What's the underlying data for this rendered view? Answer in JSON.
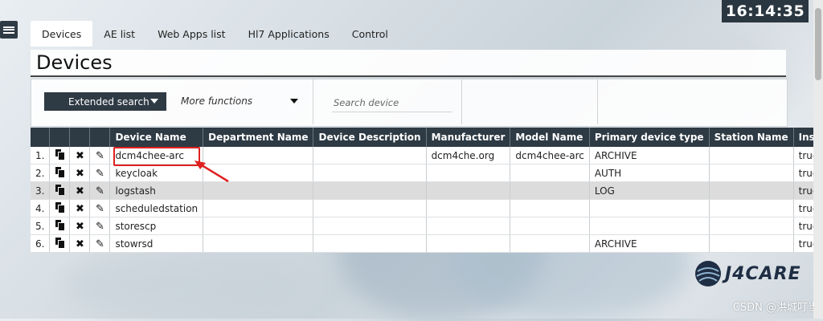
{
  "clock": "16:14:35",
  "tabs": [
    {
      "label": "Devices",
      "active": true
    },
    {
      "label": "AE list",
      "active": false
    },
    {
      "label": "Web Apps list",
      "active": false
    },
    {
      "label": "Hl7 Applications",
      "active": false
    },
    {
      "label": "Control",
      "active": false
    }
  ],
  "page_title": "Devices",
  "search_bar": {
    "extended_search_label": "Extended search",
    "more_functions_label": "More functions",
    "search_placeholder": "Search device"
  },
  "table": {
    "columns": [
      "Device Name",
      "Department Name",
      "Device Description",
      "Manufacturer",
      "Model Name",
      "Primary device type",
      "Station Name",
      "Installed"
    ],
    "rows": [
      {
        "index": "1.",
        "device_name": "dcm4chee-arc",
        "department": "",
        "description": "",
        "manufacturer": "dcm4che.org",
        "model": "dcm4chee-arc",
        "type": "ARCHIVE",
        "station": "",
        "installed": "true"
      },
      {
        "index": "2.",
        "device_name": "keycloak",
        "department": "",
        "description": "",
        "manufacturer": "",
        "model": "",
        "type": "AUTH",
        "station": "",
        "installed": "true"
      },
      {
        "index": "3.",
        "device_name": "logstash",
        "department": "",
        "description": "",
        "manufacturer": "",
        "model": "",
        "type": "LOG",
        "station": "",
        "installed": "true"
      },
      {
        "index": "4.",
        "device_name": "scheduledstation",
        "department": "",
        "description": "",
        "manufacturer": "",
        "model": "",
        "type": "",
        "station": "",
        "installed": "true"
      },
      {
        "index": "5.",
        "device_name": "storescp",
        "department": "",
        "description": "",
        "manufacturer": "",
        "model": "",
        "type": "",
        "station": "",
        "installed": "true"
      },
      {
        "index": "6.",
        "device_name": "stowrsd",
        "department": "",
        "description": "",
        "manufacturer": "",
        "model": "",
        "type": "ARCHIVE",
        "station": "",
        "installed": "true"
      }
    ]
  },
  "row_action_icons": [
    "copy-icon",
    "delete-icon",
    "edit-icon"
  ],
  "logo_text": "J4CARE",
  "watermark": "CSDN @洪城叮当",
  "colors": {
    "header_bg": "#2e3a44",
    "highlight": "#e02020",
    "alt_row": "#dcdcdc"
  }
}
